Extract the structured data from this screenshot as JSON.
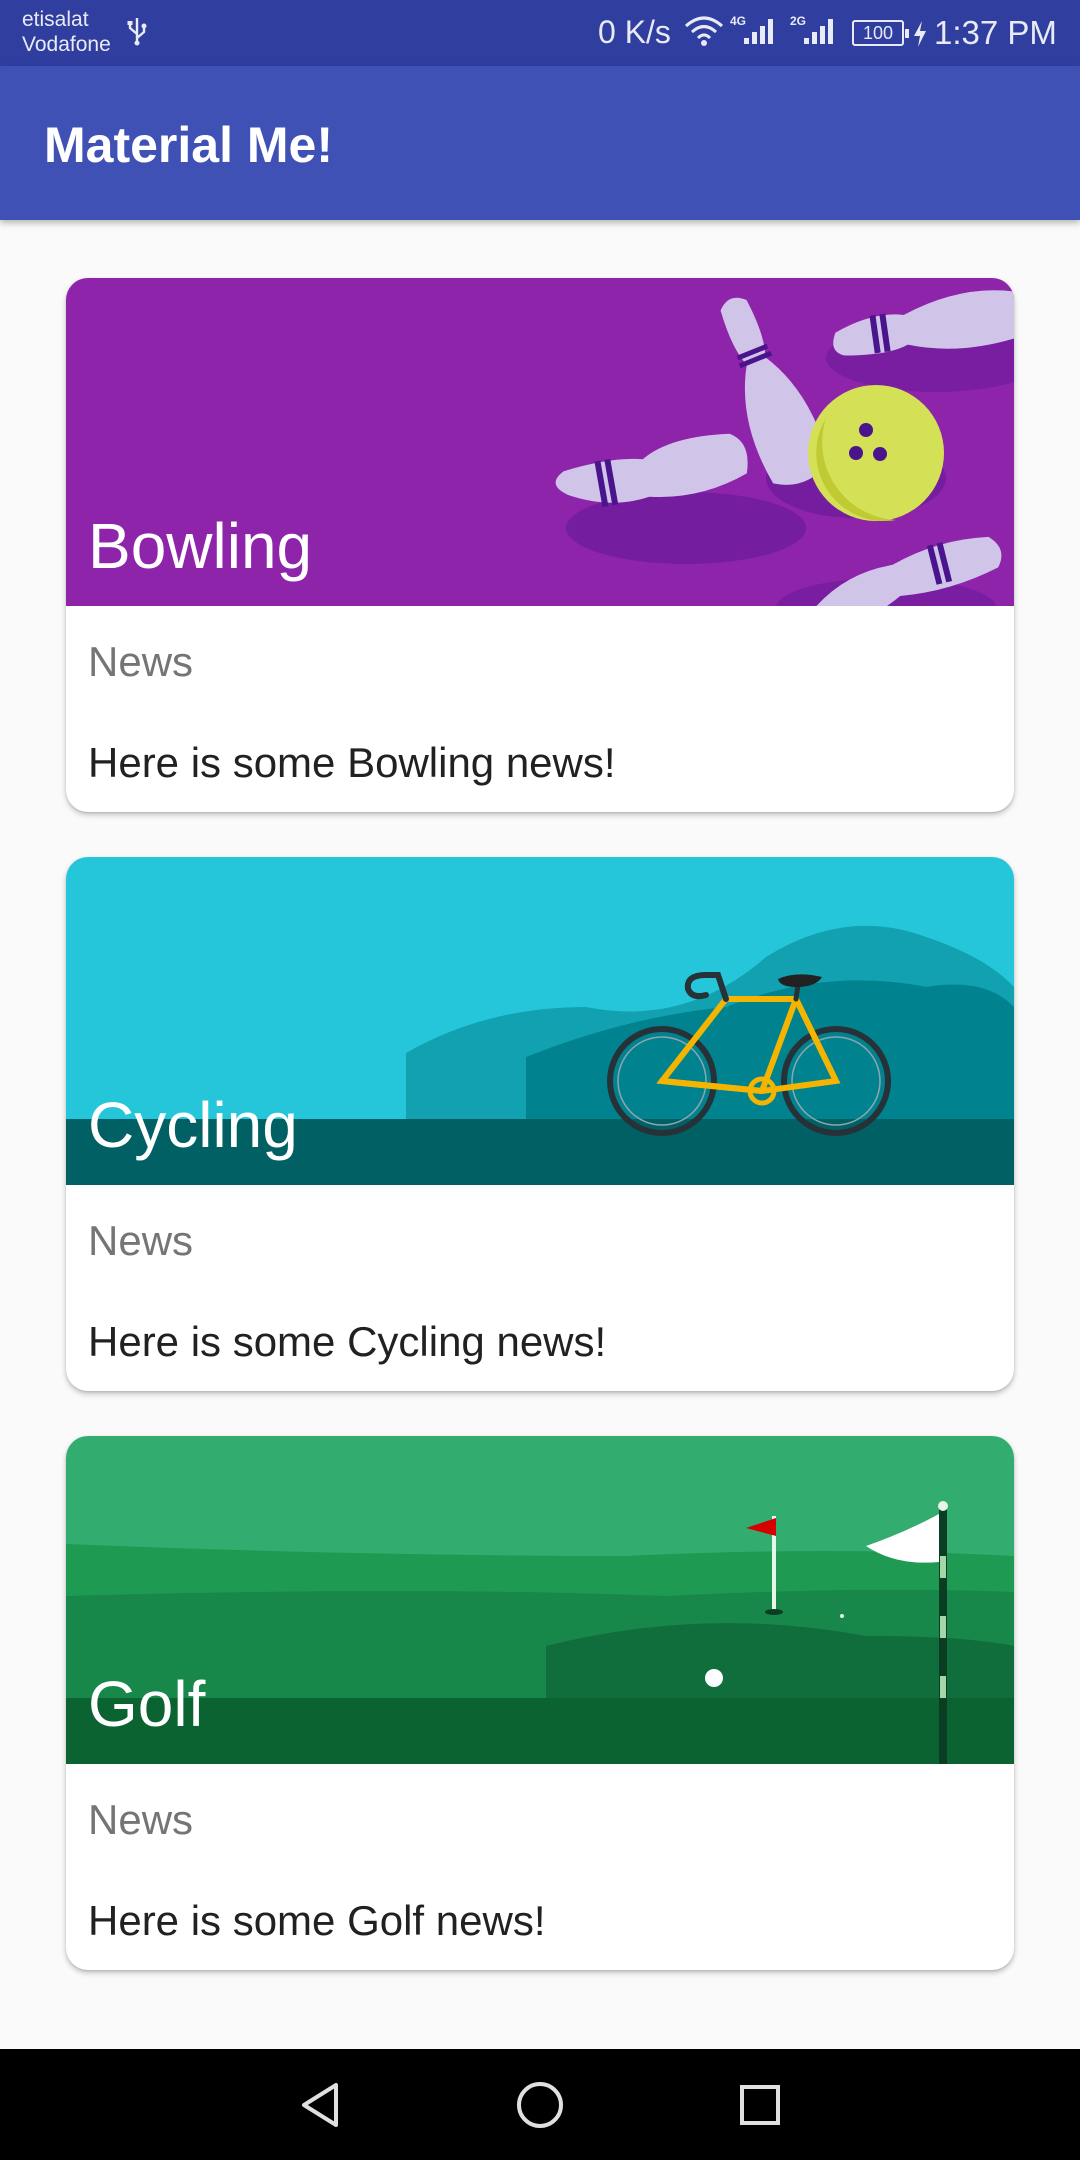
{
  "status_bar": {
    "carrier_line1": "etisalat",
    "carrier_line2": "Vodafone",
    "net_speed": "0 K/s",
    "signal1_label": "4G",
    "signal2_label": "2G",
    "battery": "100",
    "time": "1:37 PM",
    "icons": [
      "usb-icon",
      "wifi-icon",
      "signal-icon",
      "signal-icon",
      "battery-icon",
      "charging-icon"
    ]
  },
  "app_bar": {
    "title": "Material Me!",
    "color": "#3f51b5"
  },
  "cards": [
    {
      "title": "Bowling",
      "subtitle": "News",
      "info": "Here is some Bowling news!",
      "image_color": "#8e24aa"
    },
    {
      "title": "Cycling",
      "subtitle": "News",
      "info": "Here is some Cycling news!",
      "image_color": "#26c6da"
    },
    {
      "title": "Golf",
      "subtitle": "News",
      "info": "Here is some Golf news!",
      "image_color": "#2e9e5e"
    }
  ],
  "nav_bar": {
    "icons": [
      "back-icon",
      "home-icon",
      "recents-icon"
    ]
  }
}
